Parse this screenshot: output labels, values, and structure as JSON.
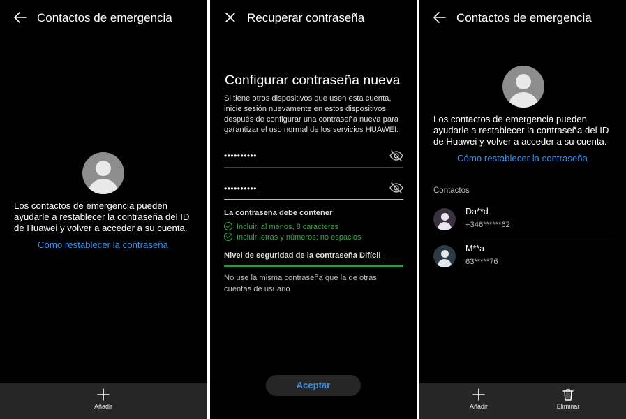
{
  "screen1": {
    "title": "Contactos de emergencia",
    "info": "Los contactos de emergencia pueden ayudarle a restablecer la contraseña del ID de Huawei y volver a acceder a su cuenta.",
    "link": "Cómo restablecer la contraseña",
    "add_label": "Añadir"
  },
  "screen2": {
    "title": "Recuperar contraseña",
    "heading": "Configurar contraseña nueva",
    "description": "Si tiene otros dispositivos que usen esta cuenta, inicie sesión nuevamente en estos dispositivos después de configurar una contraseña nueva para garantizar el uso normal de los servicios HUAWEI.",
    "password_value": "••••••••••",
    "confirm_value": "••••••••••",
    "requirements_title": "La contraseña debe contener",
    "requirements": [
      "Incluir, al menos, 8 caracteres",
      "Incluir letras y números; no espacios"
    ],
    "strength_label": "Nivel de seguridad de la contraseña Difícil",
    "strength_fraction": 1.0,
    "warning": "No use la misma contraseña que la de otras cuentas de usuario",
    "accept_label": "Aceptar"
  },
  "screen3": {
    "title": "Contactos de emergencia",
    "info": "Los contactos de emergencia pueden ayudarle a restablecer la contraseña del ID de Huawei y volver a acceder a su cuenta.",
    "link": "Cómo restablecer la contraseña",
    "section_label": "Contactos",
    "contacts": [
      {
        "name": "Da**d",
        "phone": "+346******62"
      },
      {
        "name": "M**a",
        "phone": "63*****76"
      }
    ],
    "add_label": "Añadir",
    "delete_label": "Eliminar"
  },
  "colors": {
    "accent": "#3a8ee6",
    "success": "#38a34a",
    "background": "#000000",
    "bottom_bar": "#262626"
  },
  "icons": [
    "back-arrow-icon",
    "close-icon",
    "eye-off-icon",
    "check-circle-icon",
    "plus-icon",
    "trash-icon",
    "avatar-icon"
  ]
}
